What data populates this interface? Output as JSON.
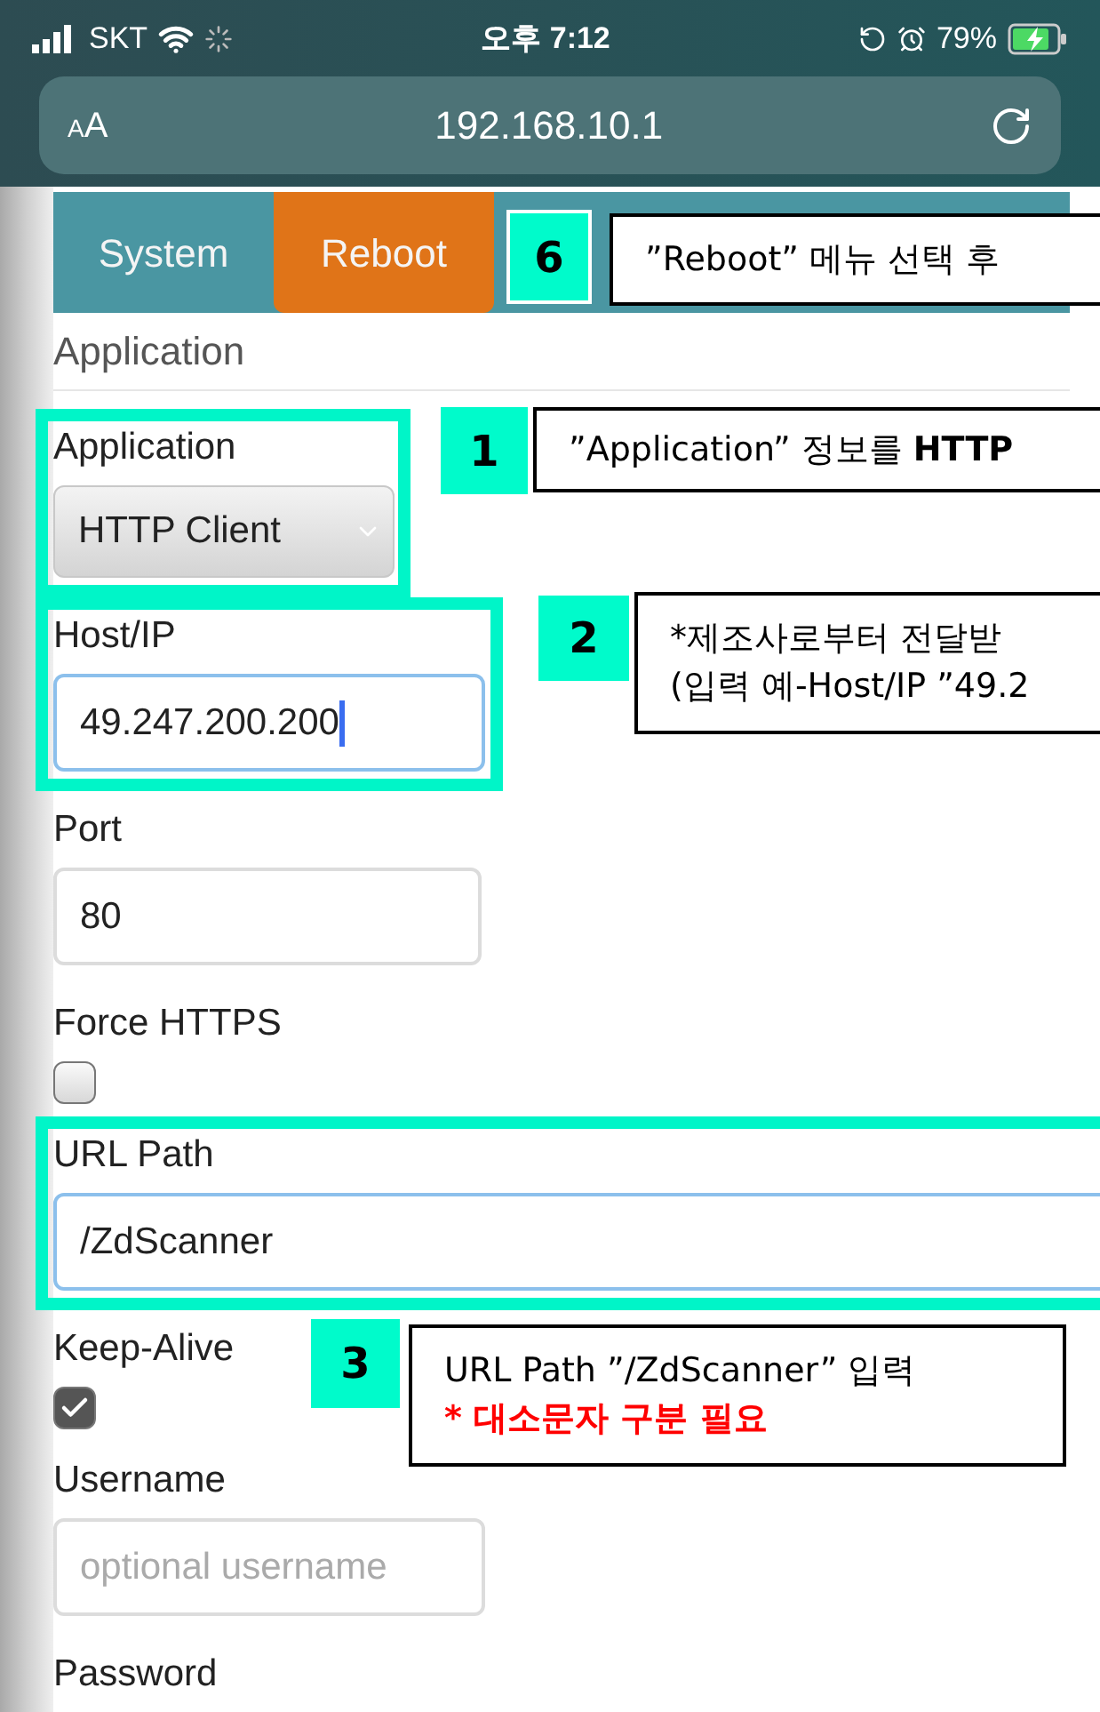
{
  "status_bar": {
    "carrier": "SKT",
    "time": "오후 7:12",
    "battery": "79%",
    "charging": true
  },
  "address_bar": {
    "text_size_small": "A",
    "text_size_large": "A",
    "url": "192.168.10.1"
  },
  "tabs": [
    {
      "label": "System",
      "selected": false
    },
    {
      "label": "Reboot",
      "selected": true
    }
  ],
  "section_title": "Application",
  "fields": [
    {
      "kind": "select",
      "label": "Application",
      "value": "HTTP Client",
      "highlighted": true
    },
    {
      "kind": "text",
      "label": "Host/IP",
      "value": "49.247.200.200",
      "focused": true,
      "highlighted": true
    },
    {
      "kind": "text",
      "label": "Port",
      "value": "80",
      "focused": false,
      "highlighted": false
    },
    {
      "kind": "checkbox",
      "label": "Force HTTPS",
      "checked": false,
      "highlighted": false
    },
    {
      "kind": "text",
      "label": "URL Path",
      "value": "/ZdScanner",
      "focused": true,
      "highlighted": true
    },
    {
      "kind": "checkbox",
      "label": "Keep-Alive",
      "checked": true,
      "highlighted": false
    },
    {
      "kind": "text",
      "label": "Username",
      "placeholder": "optional username",
      "focused": false,
      "highlighted": false
    },
    {
      "kind": "label",
      "label": "Password",
      "highlighted": false
    }
  ],
  "annotations": [
    {
      "number": "6",
      "lines": [
        {
          "text": "”Reboot” 메뉴 선택 후",
          "kind": "normal"
        }
      ]
    },
    {
      "number": "1",
      "lines": [
        {
          "text": "”Application” 정보를 **HTTP**",
          "kind": "normal"
        }
      ]
    },
    {
      "number": "2",
      "lines": [
        {
          "text": "*제조사로부터 전달받",
          "kind": "normal"
        },
        {
          "text": "(입력 예-Host/IP ”49.2",
          "kind": "normal"
        }
      ]
    },
    {
      "number": "3",
      "lines": [
        {
          "text": "URL Path ”/ZdScanner” 입력",
          "kind": "normal"
        },
        {
          "text": "* 대소문자 구분 필요",
          "kind": "warning"
        }
      ]
    }
  ]
}
